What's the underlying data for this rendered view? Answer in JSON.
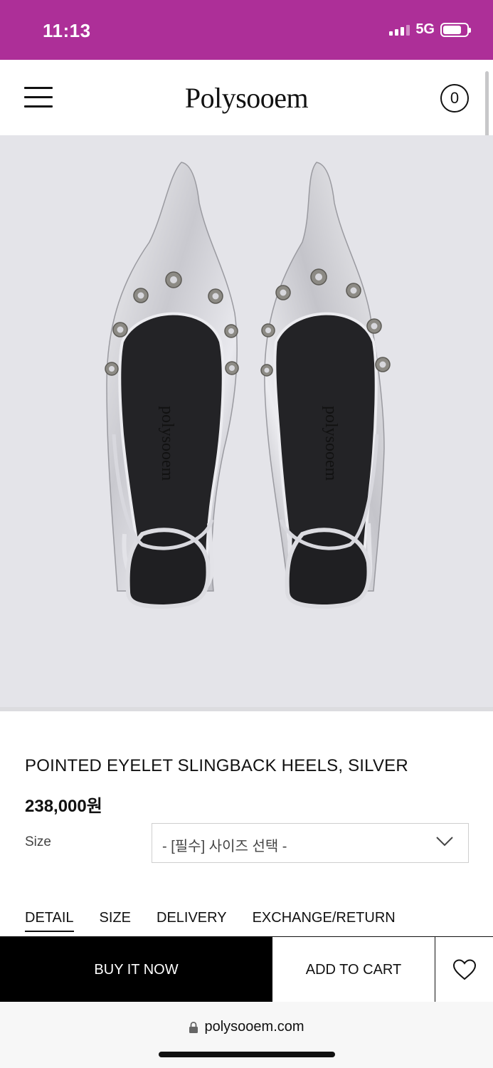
{
  "status_bar": {
    "time": "11:13",
    "network": "5G"
  },
  "header": {
    "logo": "Polysooem",
    "cart_count": "0"
  },
  "product": {
    "title": "POINTED EYELET SLINGBACK HEELS, SILVER",
    "price": "238,000원",
    "image_insole_text": "polysooem"
  },
  "size": {
    "label": "Size",
    "select_value": "- [필수] 사이즈 선택 -"
  },
  "tabs": [
    {
      "label": "DETAIL",
      "active": true
    },
    {
      "label": "SIZE",
      "active": false
    },
    {
      "label": "DELIVERY",
      "active": false
    },
    {
      "label": "EXCHANGE/RETURN",
      "active": false
    }
  ],
  "actions": {
    "buy_now": "BUY IT NOW",
    "add_to_cart": "ADD TO CART"
  },
  "browser": {
    "url": "polysooem.com"
  },
  "colors": {
    "status_bar": "#ad2f98",
    "image_bg": "#e4e4e9",
    "buy_button": "#000000"
  }
}
